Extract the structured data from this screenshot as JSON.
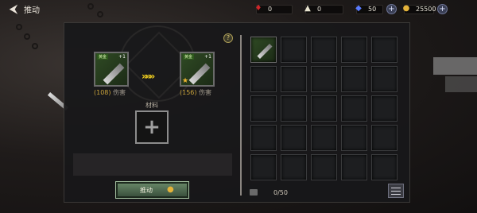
{
  "header": {
    "back_icon": "back-arrow-icon",
    "title": "推动"
  },
  "currencies": [
    {
      "name": "blood",
      "icon": "blood-drop-icon",
      "value": "0",
      "color": "#d0262a"
    },
    {
      "name": "ore",
      "icon": "ore-icon",
      "value": "0",
      "color": "#e8e4d0"
    },
    {
      "name": "crystal",
      "icon": "crystal-icon",
      "value": "50",
      "color": "#5a7cff"
    },
    {
      "name": "gold",
      "icon": "gold-coin-icon",
      "value": "25500",
      "color": "#e4b33a"
    }
  ],
  "upgrade": {
    "help_label": "?",
    "source_item": {
      "tag": "黄金",
      "level": "+1",
      "power": "(108)",
      "stat": "伤害"
    },
    "target_item": {
      "tag": "黄金",
      "level": "+1",
      "power": "(156)",
      "stat": "伤害"
    },
    "arrows": "»»»",
    "material_label": "材料",
    "material_plus": "+",
    "button_label": "推动"
  },
  "inventory": {
    "capacity": "0/50",
    "rows": 5,
    "cols": 5,
    "filled_slots": [
      0
    ]
  }
}
